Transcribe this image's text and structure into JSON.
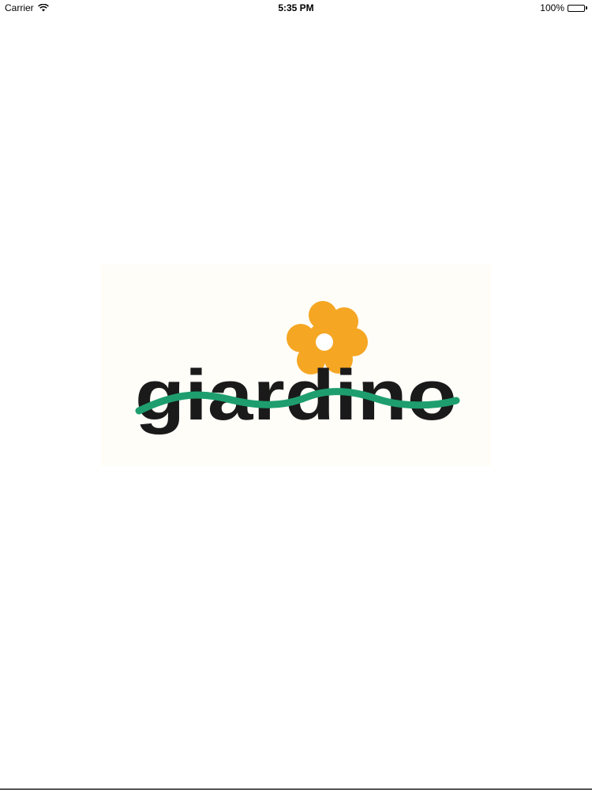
{
  "status_bar": {
    "carrier": "Carrier",
    "time": "5:35 PM",
    "battery_percent": "100%",
    "battery_level": 1.0,
    "icons": [
      "wifi-icon",
      "battery-icon"
    ]
  },
  "splash": {
    "logo_text": "giardino",
    "colors": {
      "flower": "#F5A623",
      "flower_center": "#ffffff",
      "text": "#1a1a1a",
      "wave": "#1e9e6e"
    }
  }
}
